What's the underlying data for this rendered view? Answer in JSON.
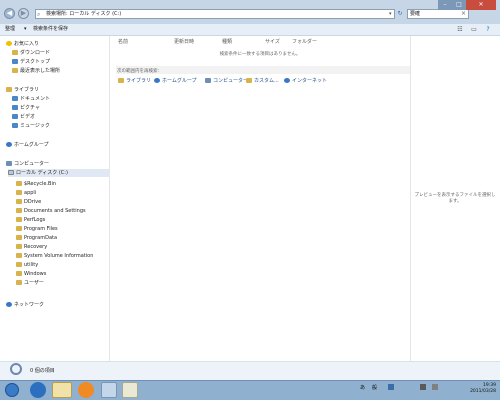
{
  "window": {
    "address_path": "検索場所: ローカル ディスク (C:)",
    "search_value": "要確",
    "buttons": {
      "minimize": "–",
      "maximize": "□",
      "close": "✕"
    }
  },
  "toolbar": {
    "organize": "整理",
    "save_search": "検索条件を保存"
  },
  "nav": {
    "favorites": {
      "header": "お気に入り",
      "items": [
        "ダウンロード",
        "デスクトップ",
        "最近表示した場所"
      ]
    },
    "libraries": {
      "header": "ライブラリ",
      "items": [
        "ドキュメント",
        "ピクチャ",
        "ビデオ",
        "ミュージック"
      ]
    },
    "homegroup": "ホームグループ",
    "computer": {
      "header": "コンピューター",
      "drive": "ローカル ディスク (C:)",
      "folders": [
        "$Recycle.Bin",
        "appli",
        "DDrive",
        "Documents and Settings",
        "PerfLogs",
        "Program Files",
        "ProgramData",
        "Recovery",
        "System Volume Information",
        "utility",
        "Windows",
        "ユーザー"
      ]
    },
    "network": "ネットワーク"
  },
  "content": {
    "columns": [
      "名前",
      "更新日時",
      "種類",
      "サイズ",
      "フォルダー"
    ],
    "no_results": "検索条件に一致する項目はありません。",
    "search_again_label": "次の範囲内を再検索:",
    "search_again_links": [
      "ライブラリ",
      "ホームグループ",
      "コンピューター",
      "カスタム...",
      "インターネット"
    ]
  },
  "preview": {
    "message": "プレビューを表示するファイルを選択します。"
  },
  "details": {
    "item_count": "0 個の項目"
  },
  "taskbar": {
    "tray": [
      "あ",
      "般"
    ],
    "clock": {
      "time": "19:39",
      "date": "2011/03/28"
    }
  }
}
